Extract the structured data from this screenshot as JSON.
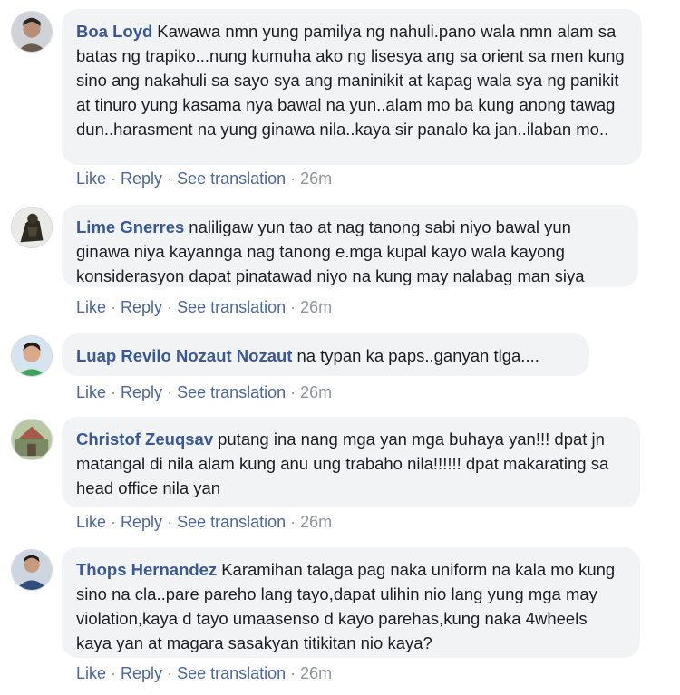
{
  "comments": [
    {
      "author": "Boa Loyd",
      "text": "Kawawa nmn yung pamilya ng nahuli.pano wala nmn alam sa batas ng trapiko...nung kumuha ako ng lisesya ang sa orient sa men kung sino ang nakahuli sa sayo sya ang maninikit at kapag wala sya ng panikit at tinuro yung kasama nya bawal na yun..alam mo ba kung anong tawag dun..harasment na yung ginawa nila..kaya sir panalo ka jan..ilaban mo..",
      "like": "Like",
      "reply": "Reply",
      "translation": "See translation",
      "time": "26m"
    },
    {
      "author": "Lime Gnerres",
      "text": "naliligaw yun tao at nag tanong sabi niyo bawal yun ginawa niya kayannga nag tanong e.mga kupal kayo wala kayong konsiderasyon dapat pinatawad niyo na kung may nalabag man siya",
      "like": "Like",
      "reply": "Reply",
      "translation": "See translation",
      "time": "26m"
    },
    {
      "author": "Luap Revilo Nozaut Nozaut",
      "text": "na typan ka paps..ganyan tlga....",
      "like": "Like",
      "reply": "Reply",
      "translation": "See translation",
      "time": "26m"
    },
    {
      "author": "Christof Zeuqsav",
      "text": "putang ina nang mga yan mga buhaya yan!!! dpat jn matangal di nila alam kung anu ung trabaho nila!!!!!! dpat makarating sa head office nila yan",
      "like": "Like",
      "reply": "Reply",
      "translation": "See translation",
      "time": "26m"
    },
    {
      "author": "Thops Hernandez",
      "text": "Karamihan talaga pag naka uniform na kala mo kung sino na cla..pare pareho lang tayo,dapat ulihin nio lang yung mga may violation,kaya d tayo umaasenso d kayo parehas,kung naka 4wheels kaya yan at magara sasakyan titikitan nio kaya?",
      "like": "Like",
      "reply": "Reply",
      "translation": "See translation",
      "time": "26m"
    }
  ],
  "separator": "·",
  "colors": {
    "author": "#385898",
    "link": "#4b67a1",
    "bubble": "#f2f3f5",
    "meta": "#90949c"
  }
}
